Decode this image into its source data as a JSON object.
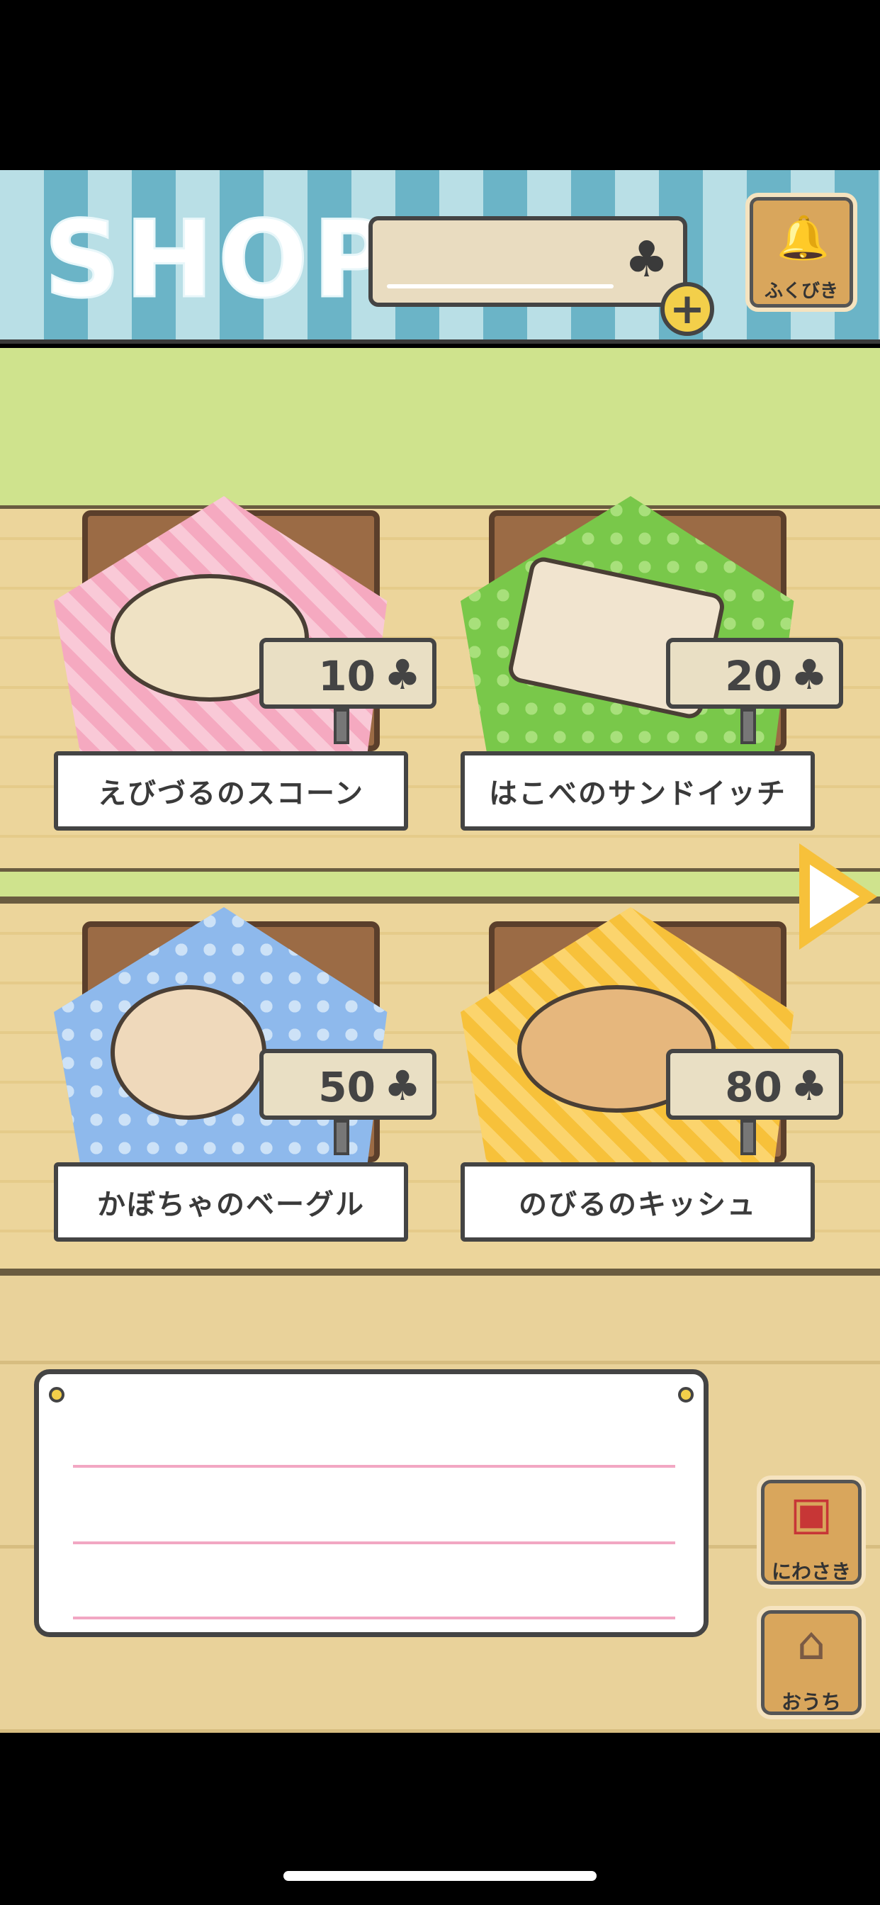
{
  "header": {
    "title": "SHOP",
    "clover_count": "",
    "clover_icon": "♣",
    "add_clover_symbol": "+",
    "lottery_label": "ふくびき"
  },
  "products": [
    {
      "name": "えびづるのスコーン",
      "price": "10",
      "clover": "♣",
      "cloth_color": "#f5a9c0"
    },
    {
      "name": "はこべのサンドイッチ",
      "price": "20",
      "clover": "♣",
      "cloth_color": "#79c84a"
    },
    {
      "name": "かぼちゃのベーグル",
      "price": "50",
      "clover": "♣",
      "cloth_color": "#8eb9ec"
    },
    {
      "name": "のびるのキッシュ",
      "price": "80",
      "clover": "♣",
      "cloth_color": "#f7c13a"
    }
  ],
  "side_buttons": {
    "garden_label": "にわさき",
    "home_label": "おうち"
  },
  "colors": {
    "stripe_light": "#b9dfe6",
    "stripe_dark": "#6bb4c7",
    "green_band": "#cfe38d",
    "wood": "#ecd59b",
    "accent_yellow": "#f3cf4a"
  }
}
